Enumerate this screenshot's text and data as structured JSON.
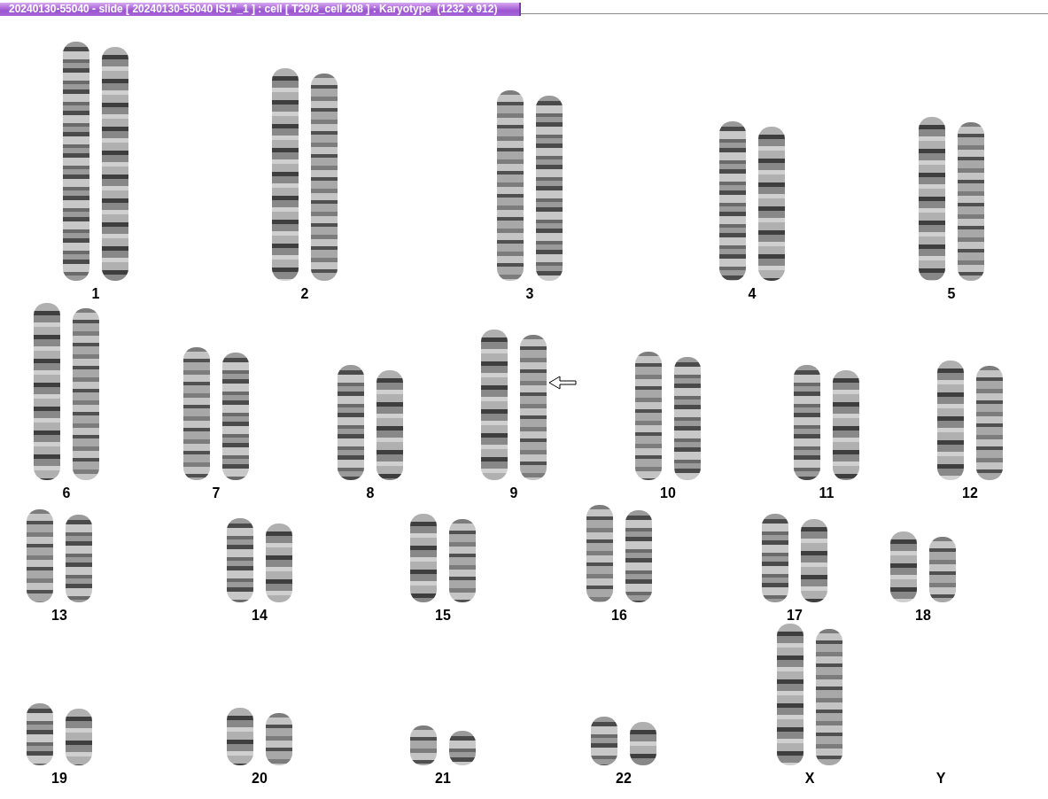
{
  "window": {
    "title": "20240130-55040 - slide [ 20240130-55040 IS1\"_1 ] : cell [ T29/3_cell 208 ] : Karyotype  (1232 x 912)"
  },
  "karyotype": {
    "rows": [
      {
        "chromosomes": [
          {
            "label": "1",
            "kind": "pair",
            "marked": false
          },
          {
            "label": "2",
            "kind": "pair",
            "marked": false
          },
          {
            "label": "3",
            "kind": "pair",
            "marked": false
          },
          {
            "label": "4",
            "kind": "pair",
            "marked": false
          },
          {
            "label": "5",
            "kind": "pair",
            "marked": false
          }
        ]
      },
      {
        "chromosomes": [
          {
            "label": "6",
            "kind": "pair",
            "marked": false
          },
          {
            "label": "7",
            "kind": "pair",
            "marked": false
          },
          {
            "label": "8",
            "kind": "pair",
            "marked": false
          },
          {
            "label": "9",
            "kind": "pair",
            "marked": true
          },
          {
            "label": "10",
            "kind": "pair",
            "marked": false
          },
          {
            "label": "11",
            "kind": "pair",
            "marked": false
          },
          {
            "label": "12",
            "kind": "pair",
            "marked": false
          }
        ]
      },
      {
        "chromosomes": [
          {
            "label": "13",
            "kind": "pair",
            "marked": false
          },
          {
            "label": "14",
            "kind": "pair",
            "marked": false
          },
          {
            "label": "15",
            "kind": "pair",
            "marked": false
          },
          {
            "label": "16",
            "kind": "pair",
            "marked": false
          },
          {
            "label": "17",
            "kind": "pair",
            "marked": false
          },
          {
            "label": "18",
            "kind": "pair",
            "marked": false
          }
        ]
      },
      {
        "chromosomes": [
          {
            "label": "19",
            "kind": "pair",
            "marked": false
          },
          {
            "label": "20",
            "kind": "pair",
            "marked": false
          },
          {
            "label": "21",
            "kind": "pair",
            "marked": false
          },
          {
            "label": "22",
            "kind": "pair",
            "marked": false
          },
          {
            "label": "X",
            "kind": "pair",
            "marked": false
          },
          {
            "label": "Y",
            "kind": "empty",
            "marked": false
          }
        ]
      }
    ]
  }
}
